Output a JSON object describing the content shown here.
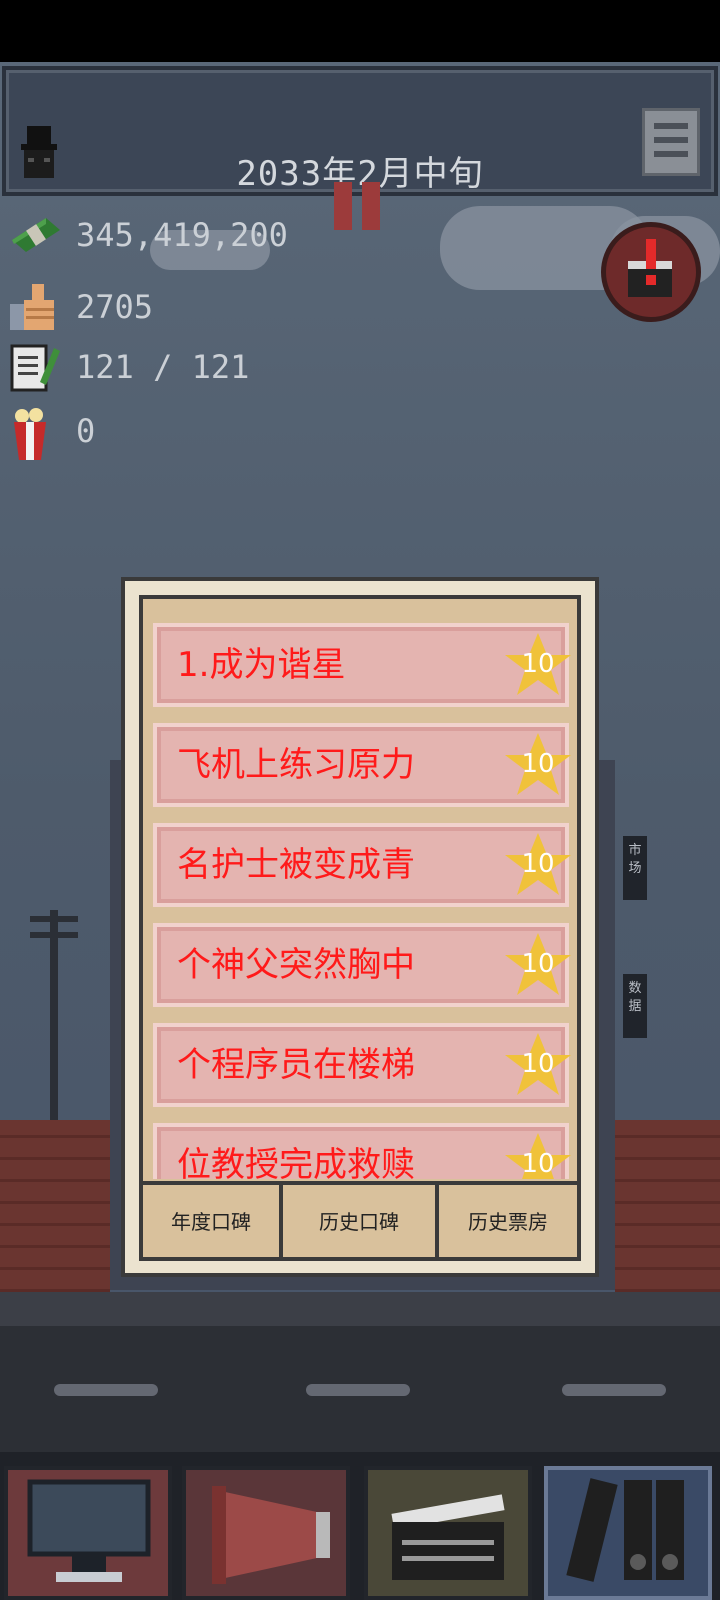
{
  "header": {
    "date": "2033年2月中旬"
  },
  "stats": {
    "money": "345,419,200",
    "likes": "2705",
    "scripts": "121 / 121",
    "popcorn": "0"
  },
  "buildings": {
    "sign_market": "市场",
    "sign_data": "数据"
  },
  "ranking": {
    "items": [
      {
        "title": "1.成为谐星",
        "stars": "10"
      },
      {
        "title": "飞机上练习原力",
        "stars": "10"
      },
      {
        "title": "名护士被变成青",
        "stars": "10"
      },
      {
        "title": "个神父突然胸中",
        "stars": "10"
      },
      {
        "title": "个程序员在楼梯",
        "stars": "10"
      },
      {
        "title": "位教授完成救赎",
        "stars": "10"
      }
    ],
    "tabs": [
      "年度口碑",
      "历史口碑",
      "历史票房"
    ]
  },
  "colors": {
    "item_text": "#ff1a1a",
    "star": "#f0c23a",
    "panel": "#d9c19c"
  },
  "icons": {
    "avatar": "top-hat-avatar-icon",
    "money": "cash-stack-icon",
    "likes": "thumbs-up-icon",
    "scripts": "notepad-pencil-icon",
    "popcorn": "popcorn-icon",
    "alert": "clapperboard-alert-icon",
    "nav": [
      "computer-monitor-icon",
      "megaphone-icon",
      "clapperboard-icon",
      "binders-icon"
    ]
  }
}
